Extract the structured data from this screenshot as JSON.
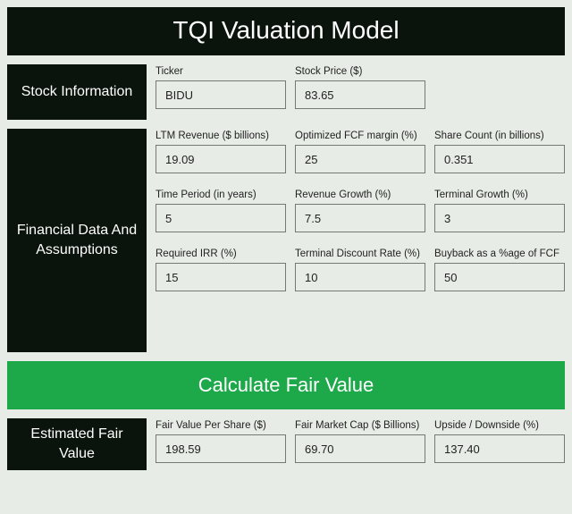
{
  "title": "TQI Valuation Model",
  "sections": {
    "stock": {
      "heading": "Stock Information",
      "ticker_label": "Ticker",
      "ticker_value": "BIDU",
      "price_label": "Stock Price ($)",
      "price_value": "83.65"
    },
    "fin": {
      "heading": "Financial Data And Assumptions",
      "ltm_rev_label": "LTM Revenue ($ billions)",
      "ltm_rev_value": "19.09",
      "fcf_margin_label": "Optimized FCF margin (%)",
      "fcf_margin_value": "25",
      "share_count_label": "Share Count (in billions)",
      "share_count_value": "0.351",
      "time_period_label": "Time Period (in years)",
      "time_period_value": "5",
      "rev_growth_label": "Revenue Growth (%)",
      "rev_growth_value": "7.5",
      "term_growth_label": "Terminal Growth (%)",
      "term_growth_value": "3",
      "req_irr_label": "Required IRR (%)",
      "req_irr_value": "15",
      "term_disc_label": "Terminal Discount Rate (%)",
      "term_disc_value": "10",
      "buyback_label": "Buyback as a %age of FCF",
      "buyback_value": "50"
    },
    "calc_button": "Calculate Fair Value",
    "est": {
      "heading": "Estimated Fair Value",
      "fvps_label": "Fair Value Per Share ($)",
      "fvps_value": "198.59",
      "fmc_label": "Fair Market Cap ($ Billions)",
      "fmc_value": "69.70",
      "upside_label": "Upside / Downside (%)",
      "upside_value": "137.40"
    }
  }
}
